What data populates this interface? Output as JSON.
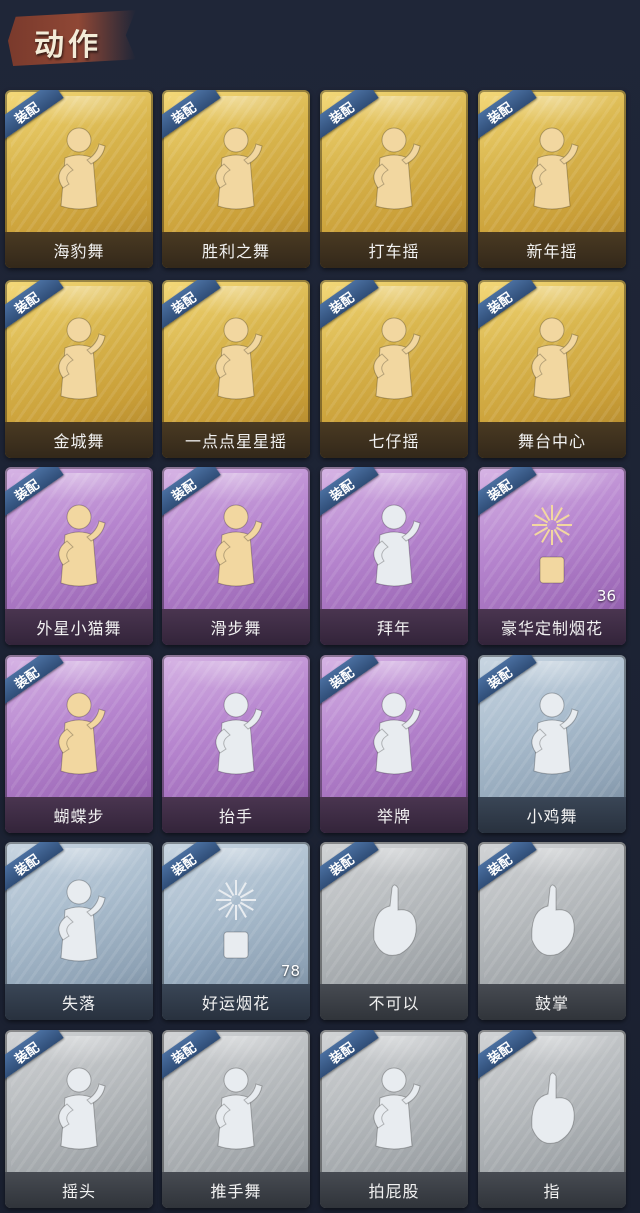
{
  "header": {
    "title": "动作"
  },
  "equip_label": "装配",
  "colors": {
    "gold": "#d9b64e",
    "purple": "#b786cf",
    "blue": "#a9bccd",
    "grey": "#b6babd",
    "figure_gold": "#f2d7a0",
    "figure_silver": "#e8ecf0"
  },
  "cards": [
    {
      "name": "海豹舞",
      "rarity": "gold",
      "equipped": true,
      "icon": "seal-dance-figure-icon"
    },
    {
      "name": "胜利之舞",
      "rarity": "gold",
      "equipped": true,
      "icon": "victory-dance-figure-icon"
    },
    {
      "name": "打车摇",
      "rarity": "gold",
      "equipped": true,
      "icon": "taxi-shake-figure-icon"
    },
    {
      "name": "新年摇",
      "rarity": "gold",
      "equipped": true,
      "icon": "new-year-shake-figure-icon"
    },
    {
      "name": "金城舞",
      "rarity": "gold",
      "equipped": true,
      "icon": "jincheng-dance-figure-icon"
    },
    {
      "name": "一点点星星摇",
      "rarity": "gold",
      "equipped": true,
      "icon": "star-shake-figure-icon"
    },
    {
      "name": "七仔摇",
      "rarity": "gold",
      "equipped": true,
      "icon": "qizai-shake-figure-icon"
    },
    {
      "name": "舞台中心",
      "rarity": "gold",
      "equipped": true,
      "icon": "stage-center-figure-icon"
    },
    {
      "name": "外星小猫舞",
      "rarity": "purple",
      "equipped": true,
      "icon": "alien-cat-dance-figure-icon"
    },
    {
      "name": "滑步舞",
      "rarity": "purple",
      "equipped": true,
      "icon": "slide-dance-figure-icon"
    },
    {
      "name": "拜年",
      "rarity": "purple",
      "equipped": true,
      "icon": "new-year-greeting-figure-icon"
    },
    {
      "name": "豪华定制烟花",
      "rarity": "purple",
      "equipped": true,
      "icon": "luxury-fireworks-icon",
      "count": "36"
    },
    {
      "name": "蝴蝶步",
      "rarity": "purple",
      "equipped": true,
      "icon": "butterfly-step-figure-icon"
    },
    {
      "name": "抬手",
      "rarity": "purple",
      "equipped": false,
      "icon": "raise-hand-figure-icon"
    },
    {
      "name": "举牌",
      "rarity": "purple",
      "equipped": true,
      "icon": "hold-sign-figure-icon"
    },
    {
      "name": "小鸡舞",
      "rarity": "blue",
      "equipped": true,
      "icon": "chicken-dance-figure-icon"
    },
    {
      "name": "失落",
      "rarity": "blue",
      "equipped": true,
      "icon": "dejected-figure-icon"
    },
    {
      "name": "好运烟花",
      "rarity": "blue",
      "equipped": true,
      "icon": "lucky-firework-icon",
      "count": "78"
    },
    {
      "name": "不可以",
      "rarity": "grey",
      "equipped": true,
      "icon": "no-finger-wag-icon"
    },
    {
      "name": "鼓掌",
      "rarity": "grey",
      "equipped": true,
      "icon": "clapping-hands-icon"
    },
    {
      "name": "摇头",
      "rarity": "grey",
      "equipped": true,
      "icon": "head-shake-figure-icon"
    },
    {
      "name": "推手舞",
      "rarity": "grey",
      "equipped": true,
      "icon": "push-hand-dance-figure-icon"
    },
    {
      "name": "拍屁股",
      "rarity": "grey",
      "equipped": true,
      "icon": "butt-slap-figure-icon"
    },
    {
      "name": "指",
      "rarity": "grey",
      "equipped": true,
      "icon": "pointing-hand-icon"
    }
  ]
}
